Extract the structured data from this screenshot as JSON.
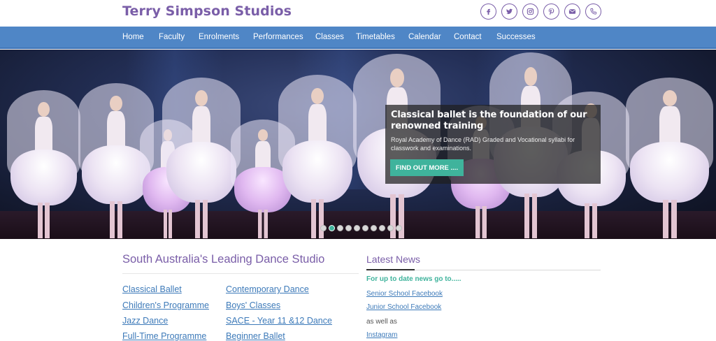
{
  "site": {
    "logo_text": "Terry Simpson Studios"
  },
  "social": [
    {
      "icon": "facebook-icon"
    },
    {
      "icon": "twitter-icon"
    },
    {
      "icon": "instagram-icon"
    },
    {
      "icon": "pinterest-icon"
    },
    {
      "icon": "email-icon"
    },
    {
      "icon": "phone-icon"
    }
  ],
  "nav": {
    "items": [
      "Home",
      "Faculty",
      "Enrolments",
      "Performances",
      "Classes",
      "Timetables",
      "Calendar",
      "Contact",
      "Successes"
    ]
  },
  "hero": {
    "caption_title": "Classical ballet is the foundation of our renowned training",
    "caption_text": "Royal Academy of Dance (RAD) Graded and Vocational syllabi for classwork and examinations.",
    "button_label": "FIND OUT MORE ....",
    "slide_count": 10,
    "active_slide": 2
  },
  "main": {
    "title": "South Australia's Leading Dance Studio",
    "links_left": [
      "Classical Ballet ",
      "Children's Programme",
      "Jazz Dance",
      "Full-Time Programme"
    ],
    "links_right": [
      "Contemporary Dance",
      "Boys' Classes",
      "SACE - Year 11 &12 Dance",
      "Beginner Ballet"
    ]
  },
  "news": {
    "title": "Latest News",
    "lead": "For up to date news go to.....",
    "senior_link": "Senior School Facebook",
    "junior_link": "Junior School Facebook",
    "as_well_as": "as well as",
    "instagram_link": "Instagram"
  },
  "colors": {
    "brand_purple": "#7a5ea8",
    "nav_blue": "#4f86c6",
    "accent_teal": "#3fb39c",
    "link_blue": "#3d7ab9"
  }
}
